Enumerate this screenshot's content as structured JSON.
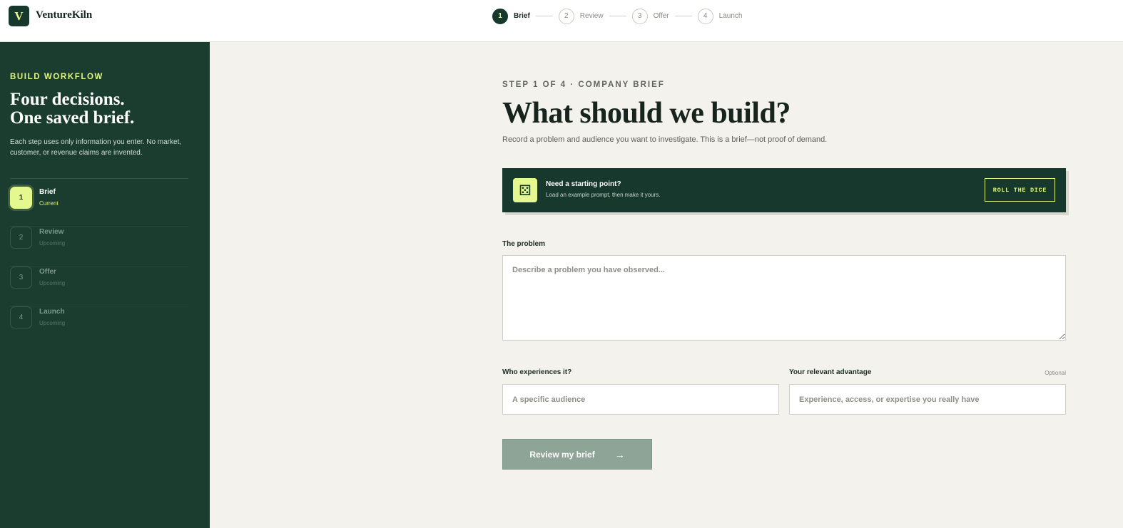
{
  "brand": {
    "mark": "V",
    "name": "VentureKiln"
  },
  "stepper": [
    {
      "num": "1",
      "label": "Brief",
      "active": true
    },
    {
      "num": "2",
      "label": "Review",
      "active": false
    },
    {
      "num": "3",
      "label": "Offer",
      "active": false
    },
    {
      "num": "4",
      "label": "Launch",
      "active": false
    }
  ],
  "sidebar": {
    "eyebrow": "BUILD WORKFLOW",
    "heading_line1": "Four decisions.",
    "heading_line2": "One saved brief.",
    "description": "Each step uses only information you enter. No market, customer, or revenue claims are invented.",
    "steps": [
      {
        "num": "1",
        "title": "Brief",
        "state": "Current"
      },
      {
        "num": "2",
        "title": "Review",
        "state": "Upcoming"
      },
      {
        "num": "3",
        "title": "Offer",
        "state": "Upcoming"
      },
      {
        "num": "4",
        "title": "Launch",
        "state": "Upcoming"
      }
    ]
  },
  "main": {
    "eyebrow": "STEP 1 OF 4 · COMPANY BRIEF",
    "title": "What should we build?",
    "subtitle": "Record a problem and audience you want to investigate. This is a brief—not proof of demand.",
    "banner": {
      "icon": "dice-icon",
      "title": "Need a starting point?",
      "subtitle": "Load an example prompt, then make it yours.",
      "button": "ROLL THE DICE"
    },
    "problem": {
      "label": "The problem",
      "placeholder": "Describe a problem you have observed..."
    },
    "audience": {
      "label": "Who experiences it?",
      "placeholder": "A specific audience"
    },
    "advantage": {
      "label": "Your relevant advantage",
      "optional": "Optional",
      "placeholder": "Experience, access, or expertise you really have"
    },
    "submit": {
      "label": "Review my brief",
      "arrow": "→"
    }
  }
}
